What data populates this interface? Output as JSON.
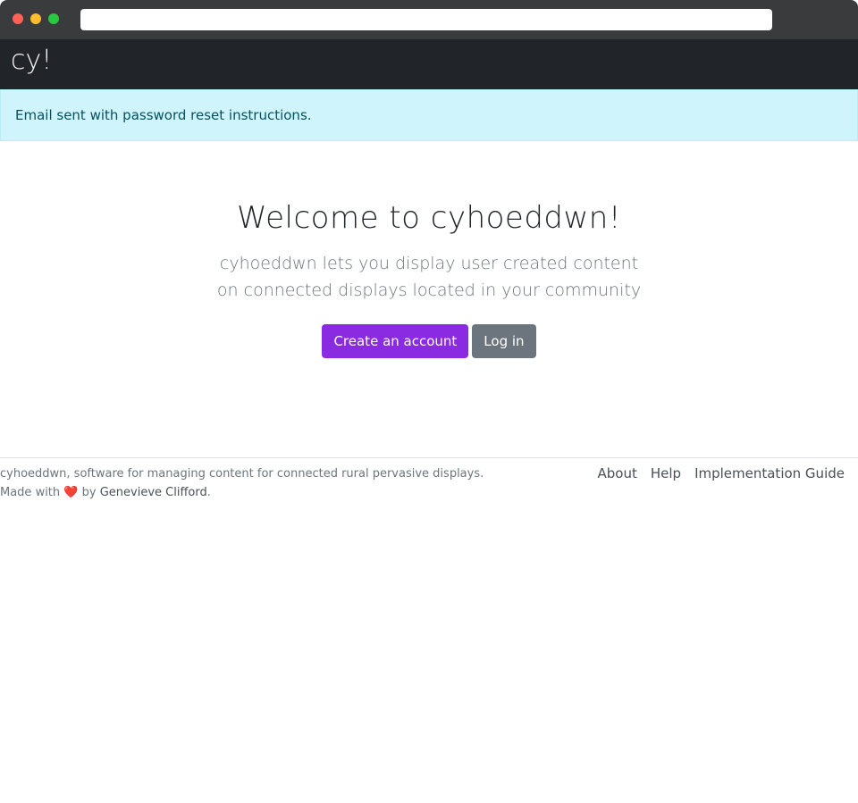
{
  "browser": {
    "url": ""
  },
  "navbar": {
    "brand": "cy!"
  },
  "alert": {
    "message": "Email sent with password reset instructions."
  },
  "hero": {
    "title": "Welcome to cyhoeddwn!",
    "lead_line1": "cyhoeddwn lets you display user created content",
    "lead_line2": "on connected displays located in your community",
    "create_account_label": "Create an account",
    "login_label": "Log in"
  },
  "footer": {
    "tagline": "cyhoeddwn, software for managing content for connected rural pervasive displays.",
    "made_with_prefix": "Made with",
    "heart": "❤️",
    "by": "by",
    "author": "Genevieve Clifford",
    "period": ".",
    "nav": [
      {
        "label": "About"
      },
      {
        "label": "Help"
      },
      {
        "label": "Implementation Guide"
      }
    ]
  },
  "colors": {
    "navbar_bg": "#212429",
    "alert_bg": "#cff4fc",
    "primary_button": "#8a2be2",
    "secondary_button": "#6c757d"
  }
}
